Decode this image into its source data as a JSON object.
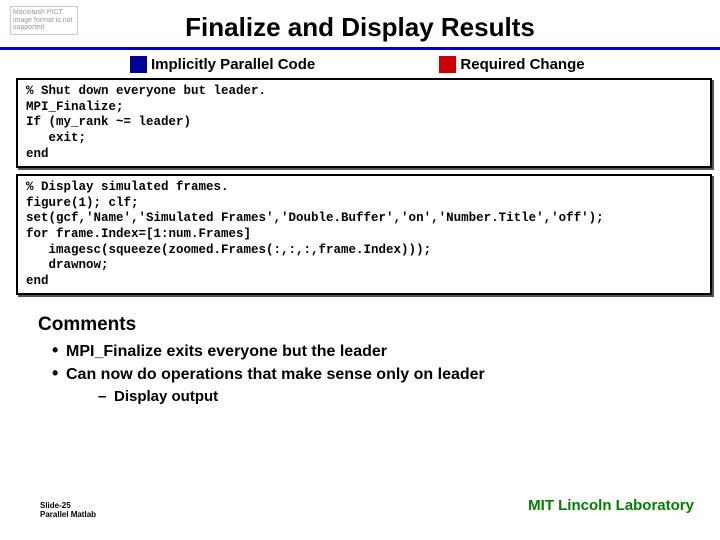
{
  "pict_placeholder": "Macintosh PICT image format is not supported",
  "title": "Finalize and Display Results",
  "legend": {
    "implicit": "Implicitly Parallel Code",
    "required": "Required Change"
  },
  "code1": "% Shut down everyone but leader.\nMPI_Finalize;\nIf (my_rank ~= leader)\n   exit;\nend",
  "code2": "% Display simulated frames.\nfigure(1); clf;\nset(gcf,'Name','Simulated Frames','Double.Buffer','on','Number.Title','off');\nfor frame.Index=[1:num.Frames]\n   imagesc(squeeze(zoomed.Frames(:,:,:,frame.Index)));\n   drawnow;\nend",
  "comments": {
    "heading": "Comments",
    "b1": "MPI_Finalize exits everyone but the leader",
    "b2": "Can now do operations that make sense only on leader",
    "sub": "Display output"
  },
  "footer": {
    "slide": "Slide-25",
    "deck": "Parallel Matlab",
    "org": "MIT Lincoln Laboratory"
  }
}
